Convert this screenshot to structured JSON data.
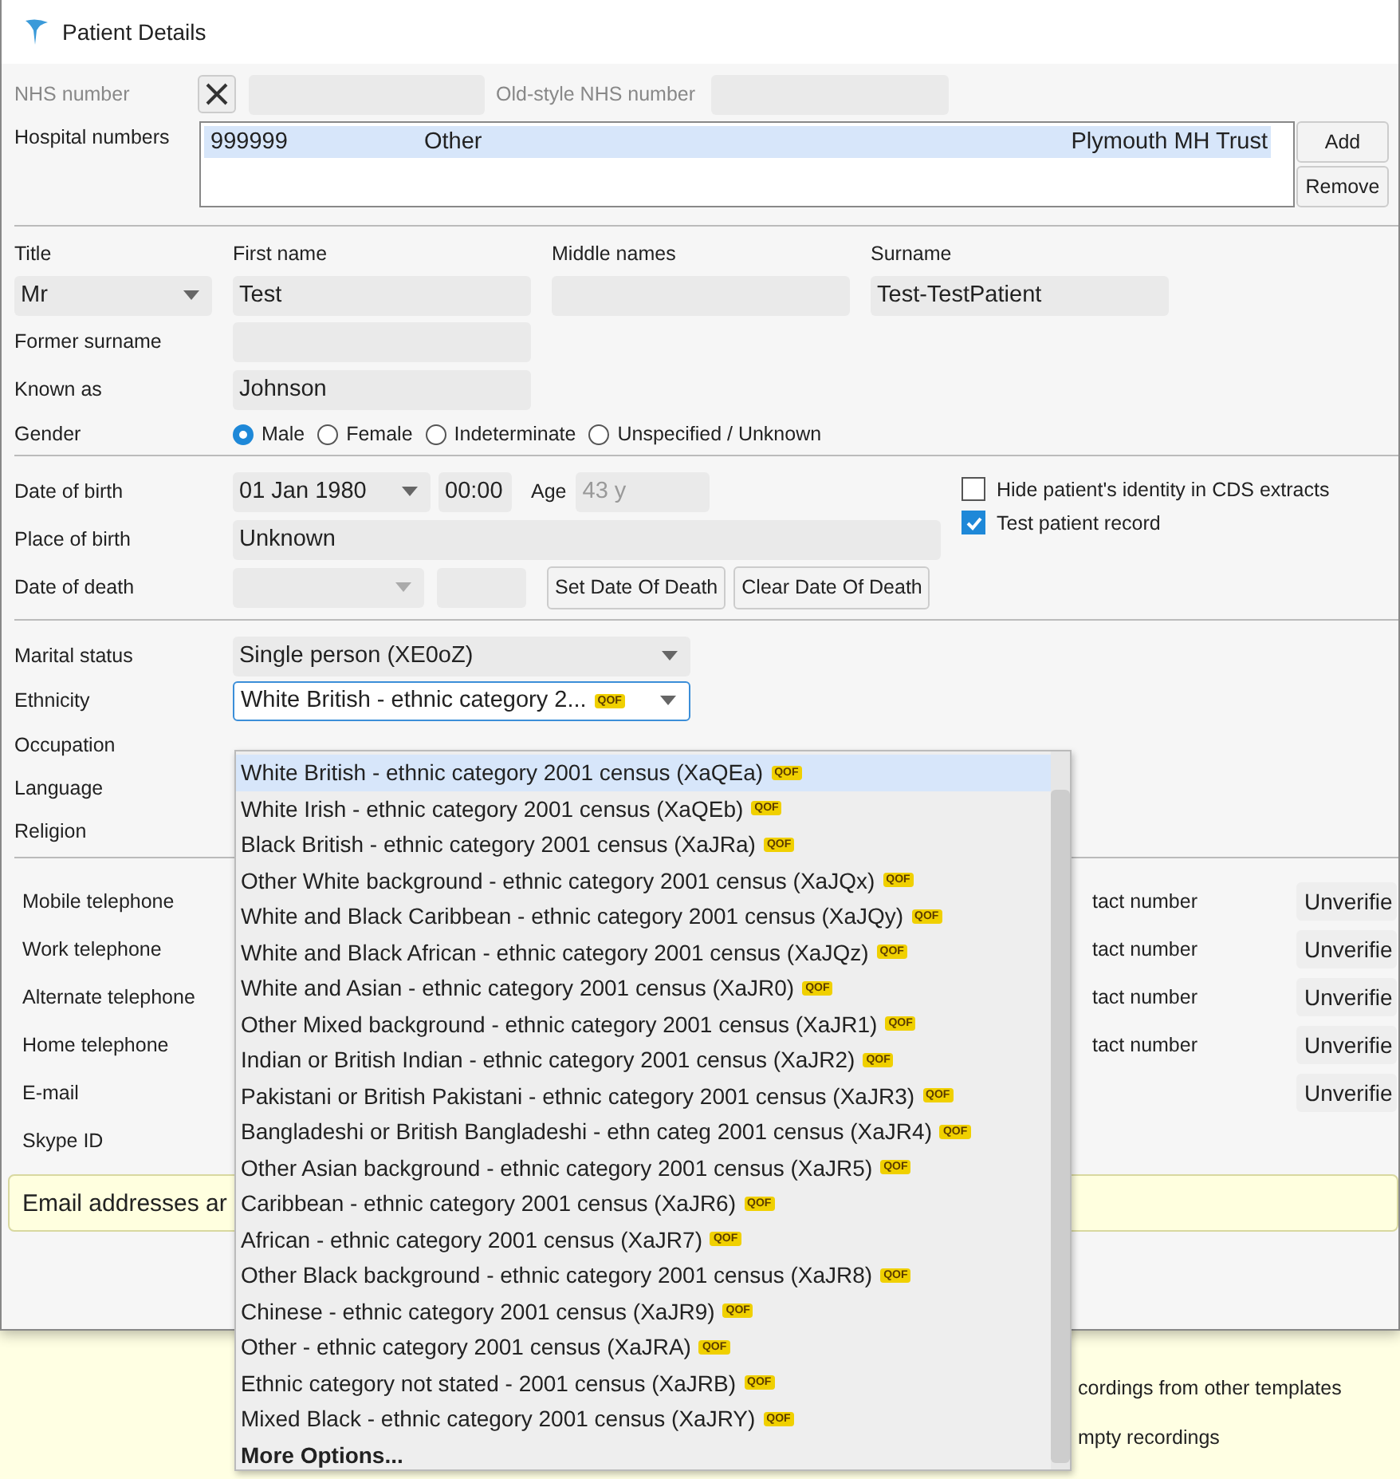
{
  "window": {
    "title": "Patient Details"
  },
  "nhs": {
    "label": "NHS number",
    "disabled": true,
    "old_style_label": "Old-style NHS number"
  },
  "hospital_numbers": {
    "label": "Hospital numbers",
    "rows": [
      {
        "number": "999999",
        "type": "Other",
        "trust": "Plymouth MH Trust",
        "selected": true
      }
    ],
    "buttons": [
      "Add",
      "Remove"
    ]
  },
  "name": {
    "title": {
      "label": "Title",
      "value": "Mr"
    },
    "first_name": {
      "label": "First name",
      "value": "Test"
    },
    "middle_names": {
      "label": "Middle names"
    },
    "surname": {
      "label": "Surname",
      "value": "Test-TestPatient"
    },
    "former_surname": {
      "label": "Former surname"
    },
    "known_as": {
      "label": "Known as",
      "value": "Johnson"
    }
  },
  "gender": {
    "label": "Gender",
    "options": [
      {
        "label": "Male",
        "selected": true
      },
      {
        "label": "Female",
        "selected": false
      },
      {
        "label": "Indeterminate",
        "selected": false
      },
      {
        "label": "Unspecified / Unknown",
        "selected": false
      }
    ]
  },
  "birth": {
    "dob_label": "Date of birth",
    "date": "01 Jan 1980",
    "time": "00:00",
    "age_label": "Age",
    "age": "43 y",
    "age_disabled": true,
    "place_label": "Place of birth",
    "place": "Unknown",
    "death_label": "Date of death",
    "buttons": [
      "Set Date Of Death",
      "Clear Date Of Death"
    ]
  },
  "flags": [
    {
      "label": "Hide patient's identity in CDS extracts",
      "checked": false
    },
    {
      "label": "Test patient record",
      "checked": true
    }
  ],
  "marital_status": {
    "label": "Marital status",
    "value": "Single person (XE0oZ)"
  },
  "ethnicity": {
    "label": "Ethnicity",
    "value": "White British - ethnic category 2...",
    "badge": "QOF",
    "focused": true
  },
  "other_fields": [
    "Occupation",
    "Language",
    "Religion"
  ],
  "contacts": [
    {
      "label": "Mobile telephone",
      "side_label": "tact number",
      "status": "Unverifie"
    },
    {
      "label": "Work telephone",
      "side_label": "tact number",
      "status": "Unverifie"
    },
    {
      "label": "Alternate telephone",
      "side_label": "tact number",
      "status": "Unverifie"
    },
    {
      "label": "Home telephone",
      "side_label": "tact number",
      "status": "Unverifie"
    },
    {
      "label": "E-mail",
      "status": "Unverifie"
    },
    {
      "label": "Skype ID"
    }
  ],
  "banner": "Email addresses ar",
  "background": {
    "texts": [
      "cordings from other templates",
      "mpty recordings"
    ]
  },
  "dropdown": {
    "items": [
      {
        "label": "White British - ethnic category 2001 census (XaQEa)",
        "badge": "QOF",
        "selected": true
      },
      {
        "label": "White Irish - ethnic category 2001 census (XaQEb)",
        "badge": "QOF",
        "selected": false
      },
      {
        "label": "Black British - ethnic category 2001 census (XaJRa)",
        "badge": "QOF",
        "selected": false
      },
      {
        "label": "Other White background - ethnic category 2001 census (XaJQx)",
        "badge": "QOF",
        "selected": false
      },
      {
        "label": "White and Black Caribbean - ethnic category 2001 census (XaJQy)",
        "badge": "QOF",
        "selected": false
      },
      {
        "label": "White and Black African - ethnic category 2001 census (XaJQz)",
        "badge": "QOF",
        "selected": false
      },
      {
        "label": "White and Asian - ethnic category 2001 census (XaJR0)",
        "badge": "QOF",
        "selected": false
      },
      {
        "label": "Other Mixed background - ethnic category 2001 census (XaJR1)",
        "badge": "QOF",
        "selected": false
      },
      {
        "label": "Indian or British Indian - ethnic category 2001 census (XaJR2)",
        "badge": "QOF",
        "selected": false
      },
      {
        "label": "Pakistani or British Pakistani - ethnic category 2001 census (XaJR3)",
        "badge": "QOF",
        "selected": false
      },
      {
        "label": "Bangladeshi or British Bangladeshi - ethn categ 2001 census (XaJR4)",
        "badge": "QOF",
        "selected": false
      },
      {
        "label": "Other Asian background - ethnic category 2001 census (XaJR5)",
        "badge": "QOF",
        "selected": false
      },
      {
        "label": "Caribbean - ethnic category 2001 census (XaJR6)",
        "badge": "QOF",
        "selected": false
      },
      {
        "label": "African - ethnic category 2001 census (XaJR7)",
        "badge": "QOF",
        "selected": false
      },
      {
        "label": "Other Black background - ethnic category 2001 census (XaJR8)",
        "badge": "QOF",
        "selected": false
      },
      {
        "label": "Chinese - ethnic category 2001 census (XaJR9)",
        "badge": "QOF",
        "selected": false
      },
      {
        "label": "Other - ethnic category 2001 census (XaJRA)",
        "badge": "QOF",
        "selected": false
      },
      {
        "label": "Ethnic category not stated - 2001 census (XaJRB)",
        "badge": "QOF",
        "selected": false
      },
      {
        "label": "Mixed Black - ethnic category 2001 census (XaJRY)",
        "badge": "QOF",
        "selected": false
      }
    ],
    "more": "More Options..."
  }
}
